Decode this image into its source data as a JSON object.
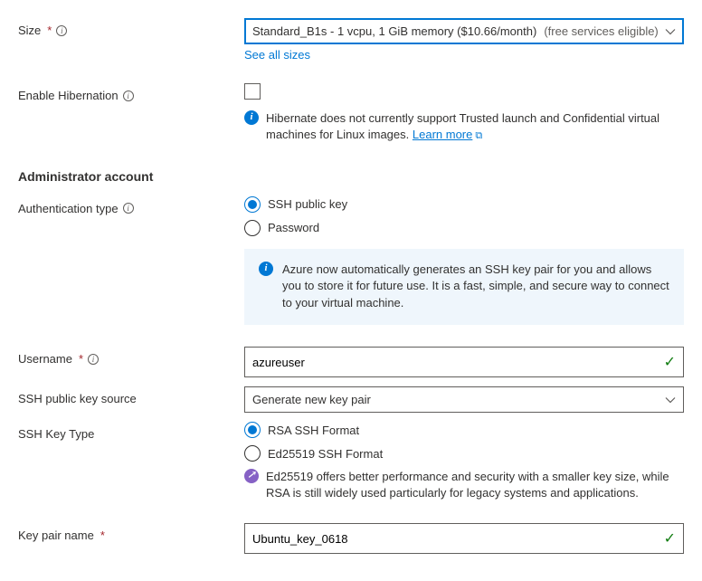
{
  "size": {
    "label": "Size",
    "value": "Standard_B1s - 1 vcpu, 1 GiB memory ($10.66/month)",
    "hint": "(free services eligible)",
    "see_all": "See all sizes"
  },
  "hibernation": {
    "label": "Enable Hibernation",
    "info": "Hibernate does not currently support Trusted launch and Confidential virtual machines for Linux images.",
    "learn_more": "Learn more"
  },
  "admin": {
    "title": "Administrator account",
    "auth_type": {
      "label": "Authentication type",
      "ssh": "SSH public key",
      "password": "Password"
    },
    "callout": "Azure now automatically generates an SSH key pair for you and allows you to store it for future use. It is a fast, simple, and secure way to connect to your virtual machine.",
    "username": {
      "label": "Username",
      "value": "azureuser"
    },
    "key_source": {
      "label": "SSH public key source",
      "value": "Generate new key pair"
    },
    "key_type": {
      "label": "SSH Key Type",
      "rsa": "RSA SSH Format",
      "ed25519": "Ed25519 SSH Format",
      "note": "Ed25519 offers better performance and security with a smaller key size, while RSA is still widely used particularly for legacy systems and applications."
    },
    "key_pair_name": {
      "label": "Key pair name",
      "value": "Ubuntu_key_0618"
    }
  }
}
